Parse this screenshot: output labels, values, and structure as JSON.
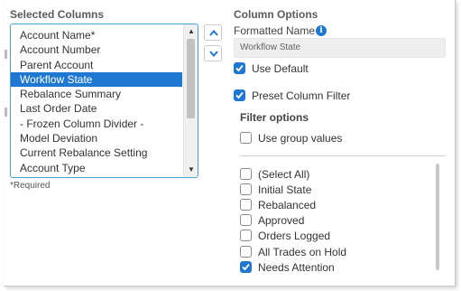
{
  "selected_columns": {
    "title": "Selected Columns",
    "items": [
      "Account Name*",
      "Account Number",
      "Parent Account",
      "Workflow State",
      "Rebalance Summary",
      "Last Order Date",
      "- Frozen Column Divider -",
      "Model Deviation",
      "Current Rebalance Setting",
      "Account Type"
    ],
    "selected_item": "Workflow State",
    "required_note": "*Required"
  },
  "reorder": {
    "up_icon": "chevron-up-icon",
    "down_icon": "chevron-down-icon"
  },
  "column_options": {
    "title": "Column Options",
    "formatted_name_label": "Formatted Name",
    "formatted_name_value": "Workflow State",
    "use_default": {
      "label": "Use Default",
      "checked": true
    },
    "preset_filter": {
      "label": "Preset Column Filter",
      "checked": true
    },
    "filter_options_label": "Filter options",
    "use_group_values": {
      "label": "Use group values",
      "checked": false
    },
    "filter_values": [
      {
        "label": "(Select All)",
        "checked": false
      },
      {
        "label": "Initial State",
        "checked": false
      },
      {
        "label": "Rebalanced",
        "checked": false
      },
      {
        "label": "Approved",
        "checked": false
      },
      {
        "label": "Orders Logged",
        "checked": false
      },
      {
        "label": "All Trades on Hold",
        "checked": false
      },
      {
        "label": "Needs Attention",
        "checked": true
      }
    ]
  },
  "colors": {
    "accent": "#1e78d2",
    "list_border": "#4ba0d8"
  }
}
